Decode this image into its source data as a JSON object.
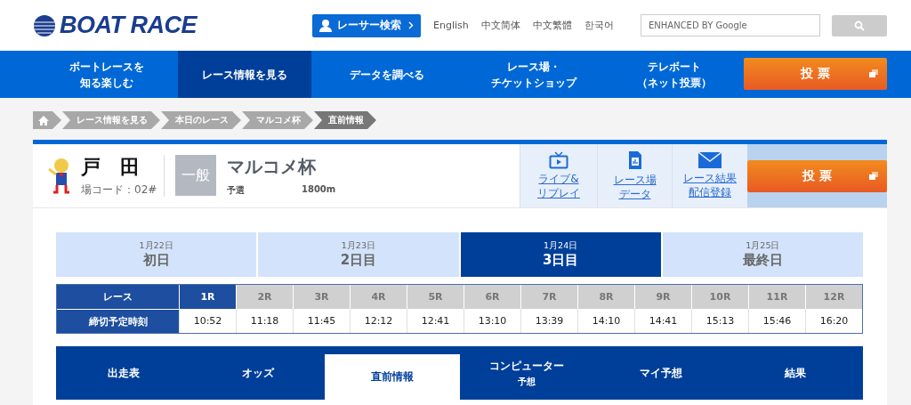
{
  "header": {
    "logo": "BOAT RACE",
    "racer_search": "レーサー検索",
    "languages": [
      "English",
      "中文简体",
      "中文繁體",
      "한국어"
    ],
    "search": {
      "placeholder": "ENHANCED BY Google"
    }
  },
  "nav": {
    "items": [
      {
        "lines": [
          "ボートレースを",
          "知る楽しむ"
        ],
        "selected": false
      },
      {
        "lines": [
          "レース情報を見る"
        ],
        "selected": true
      },
      {
        "lines": [
          "データを調べる"
        ],
        "selected": false
      },
      {
        "lines": [
          "レース場・",
          "チケットショップ"
        ],
        "selected": false
      },
      {
        "lines": [
          "テレボート",
          "（ネット投票）"
        ],
        "selected": false
      }
    ],
    "vote": "投 票"
  },
  "breadcrumb": [
    {
      "label": "レース情報を見る",
      "selected": false
    },
    {
      "label": "本日のレース",
      "selected": false
    },
    {
      "label": "マルコメ杯",
      "selected": false
    },
    {
      "label": "直前情報",
      "selected": true
    }
  ],
  "venue": {
    "name": "戸　田",
    "code": "場コード：02#",
    "grade": "一般",
    "title": "マルコメ杯",
    "stage": "予選",
    "distance": "1800m",
    "links": [
      {
        "kind": "tv",
        "lines": [
          "ライブ&",
          "リプレイ"
        ]
      },
      {
        "kind": "chart",
        "lines": [
          "レース場",
          "データ"
        ]
      },
      {
        "kind": "mail",
        "lines": [
          "レース結果",
          "配信登録"
        ]
      }
    ],
    "vote": "投 票"
  },
  "days": [
    {
      "date": "1月22日",
      "label": "初日",
      "selected": false
    },
    {
      "date": "1月23日",
      "label": "2日目",
      "selected": false
    },
    {
      "date": "1月24日",
      "label": "3日目",
      "selected": true
    },
    {
      "date": "1月25日",
      "label": "最終日",
      "selected": false
    }
  ],
  "races": {
    "race_header": "レース",
    "time_header": "締切予定時刻",
    "items": [
      {
        "label": "1R",
        "time": "10:52",
        "selected": true
      },
      {
        "label": "2R",
        "time": "11:18",
        "selected": false
      },
      {
        "label": "3R",
        "time": "11:45",
        "selected": false
      },
      {
        "label": "4R",
        "time": "12:12",
        "selected": false
      },
      {
        "label": "5R",
        "time": "12:41",
        "selected": false
      },
      {
        "label": "6R",
        "time": "13:10",
        "selected": false
      },
      {
        "label": "7R",
        "time": "13:39",
        "selected": false
      },
      {
        "label": "8R",
        "time": "14:10",
        "selected": false
      },
      {
        "label": "9R",
        "time": "14:41",
        "selected": false
      },
      {
        "label": "10R",
        "time": "15:13",
        "selected": false
      },
      {
        "label": "11R",
        "time": "15:46",
        "selected": false
      },
      {
        "label": "12R",
        "time": "16:20",
        "selected": false
      }
    ]
  },
  "tabs": [
    {
      "label": "出走表",
      "selected": false
    },
    {
      "label": "オッズ",
      "selected": false
    },
    {
      "label": "直前情報",
      "selected": true
    },
    {
      "label": "コンピューター",
      "sub": "予想",
      "selected": false
    },
    {
      "label": "マイ予想",
      "selected": false
    },
    {
      "label": "結果",
      "selected": false
    }
  ]
}
